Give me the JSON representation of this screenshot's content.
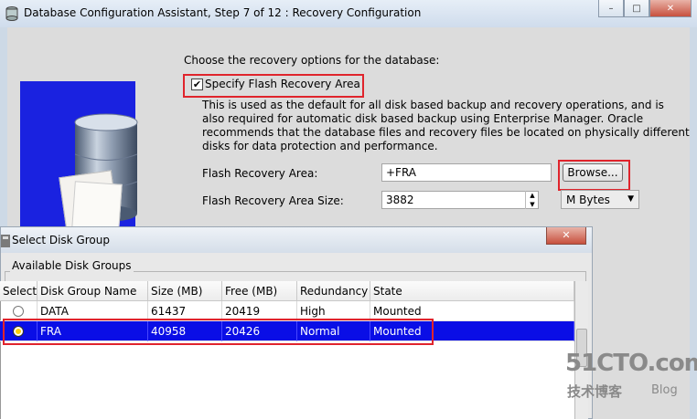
{
  "window": {
    "title": "Database Configuration Assistant, Step 7 of 12 : Recovery Configuration",
    "minimize": "–",
    "maximize": "□",
    "close": "✕"
  },
  "recovery": {
    "intro": "Choose the recovery options for the database:",
    "checkbox_label": "Specify Flash Recovery Area",
    "checkbox_checked": true,
    "description": [
      "This is used as the default for all disk based backup and recovery operations, and is",
      "also required for automatic disk based backup using Enterprise Manager. Oracle",
      "recommends that the database files and recovery files be located on physically different",
      "disks for data protection and performance."
    ],
    "area_label": "Flash Recovery Area:",
    "area_value": "+FRA",
    "browse_label": "Browse...",
    "size_label": "Flash Recovery Area Size:",
    "size_value": "3882",
    "unit_value": "M Bytes"
  },
  "dialog": {
    "title": "Select Disk Group",
    "close": "✕",
    "group_label": "Available Disk Groups",
    "columns": [
      "Select",
      "Disk Group Name",
      "Size (MB)",
      "Free (MB)",
      "Redundancy",
      "State"
    ],
    "rows": [
      {
        "selected": false,
        "name": "DATA",
        "size": "61437",
        "free": "20419",
        "redundancy": "High",
        "state": "Mounted"
      },
      {
        "selected": true,
        "name": "FRA",
        "size": "40958",
        "free": "20426",
        "redundancy": "Normal",
        "state": "Mounted"
      }
    ]
  },
  "watermark": {
    "site": "51CTO.com",
    "sub": "技术博客",
    "blog": "Blog"
  },
  "icons": [
    "app-icon",
    "database-icon",
    "dialog-icon",
    "checkmark-icon",
    "spinner-icon",
    "dropdown-arrow-icon"
  ],
  "colors": {
    "highlight_red": "#e0242c",
    "selection_blue": "#0a0ee6",
    "graphic_blue": "#1a22e0"
  }
}
